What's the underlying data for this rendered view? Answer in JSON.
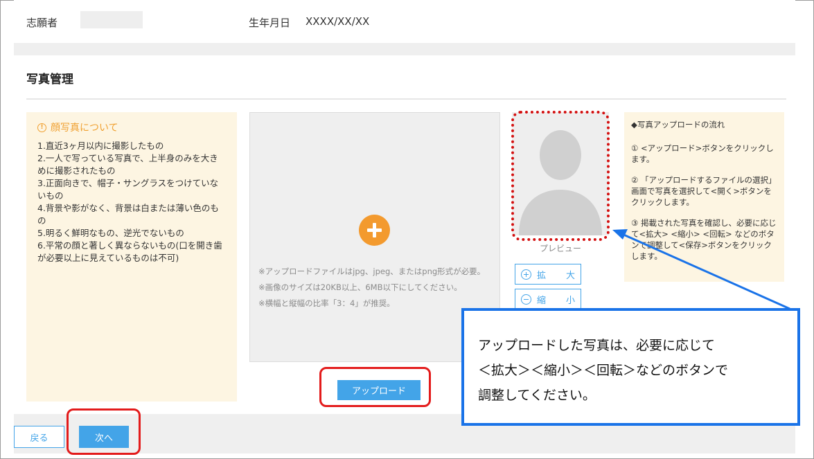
{
  "header": {
    "applicant_label": "志願者",
    "birthdate_label": "生年月日",
    "birthdate_value": "XXXX/XX/XX"
  },
  "section": {
    "title": "写真管理"
  },
  "guidelines": {
    "heading": "顔写真について",
    "items": [
      "1.直近3ヶ月以内に撮影したもの",
      "2.一人で写っている写真で、上半身のみを大きめに撮影されたもの",
      "3.正面向きで、帽子・サングラスをつけていないもの",
      "4.背景や影がなく、背景は白または薄い色のもの",
      "5.明るく鮮明なもの、逆光でないもの",
      "6.平常の顔と著しく異ならないもの(口を開き歯が必要以上に見えているものは不可)"
    ]
  },
  "upload": {
    "notes": [
      "※アップロードファイルはjpg、jpeg、またはpng形式が必要。",
      "※画像のサイズは20KB以上、6MB以下にしてください。",
      "※横幅と縦幅の比率「3：4」が推奨。"
    ],
    "button_label": "アップロード"
  },
  "preview": {
    "label": "プレビュー",
    "zoom_in": [
      "拡",
      "大"
    ],
    "zoom_out": [
      "縮",
      "小"
    ]
  },
  "flow": {
    "heading": "◆写真アップロードの流れ",
    "steps": [
      "① <アップロード>ボタンをクリックします。",
      "② 「アップロードするファイルの選択」画面で写真を選択して<開く>ボタンをクリックします。",
      "③ 掲載された写真を確認し、必要に応じて<拡大> <縮小> <回転> などのボタンで調整して<保存>ボタンをクリックします。"
    ]
  },
  "footer": {
    "back_label": "戻る",
    "next_label": "次へ"
  },
  "callout": {
    "line1": "アップロードした写真は、必要に応じて",
    "line2": "＜拡大＞＜縮小＞＜回転＞などのボタンで",
    "line3": "調整してください。"
  },
  "colors": {
    "accent_blue": "#43a4e8",
    "accent_orange": "#f39a2e",
    "note_bg": "#fdf5e2",
    "annotation_red": "#e31b1b",
    "callout_blue": "#1a73e8"
  }
}
